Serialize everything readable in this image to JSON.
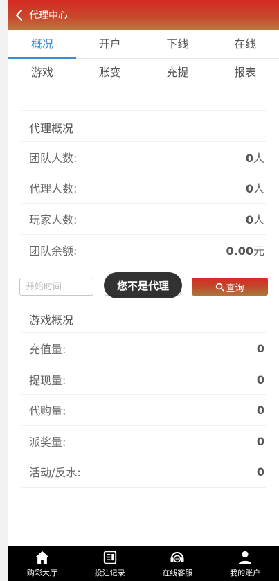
{
  "header": {
    "title": "代理中心"
  },
  "tabs_row1": [
    {
      "label": "概况",
      "active": true
    },
    {
      "label": "开户"
    },
    {
      "label": "下线"
    },
    {
      "label": "在线"
    }
  ],
  "tabs_row2": [
    {
      "label": "游戏"
    },
    {
      "label": "账变"
    },
    {
      "label": "充提"
    },
    {
      "label": "报表"
    }
  ],
  "agent_overview": {
    "title": "代理概况",
    "rows": [
      {
        "label": "团队人数:",
        "value": "0",
        "unit": "人"
      },
      {
        "label": "代理人数:",
        "value": "0",
        "unit": "人"
      },
      {
        "label": "玩家人数:",
        "value": "0",
        "unit": "人"
      },
      {
        "label": "团队余额:",
        "value": "0.00",
        "unit": "元"
      }
    ]
  },
  "filter": {
    "start_placeholder": "开始时间",
    "end_placeholder": "",
    "query_label": "查询"
  },
  "toast": {
    "message": "您不是代理"
  },
  "game_overview": {
    "title": "游戏概况",
    "rows": [
      {
        "label": "充值量:",
        "value": "0"
      },
      {
        "label": "提现量:",
        "value": "0"
      },
      {
        "label": "代购量:",
        "value": "0"
      },
      {
        "label": "派奖量:",
        "value": "0"
      },
      {
        "label": "活动/反水:",
        "value": "0"
      }
    ]
  },
  "bottom_nav": [
    {
      "label": "购彩大厅",
      "icon": "home-icon"
    },
    {
      "label": "投注记录",
      "icon": "record-icon"
    },
    {
      "label": "在线客服",
      "icon": "headset-icon"
    },
    {
      "label": "我的账户",
      "icon": "user-icon"
    }
  ],
  "colors": {
    "header_gradient_top": "#d62a22",
    "header_gradient_bottom": "#b97a40",
    "tab_active": "#3a8ed6",
    "bottom_nav_bg": "#000000"
  }
}
